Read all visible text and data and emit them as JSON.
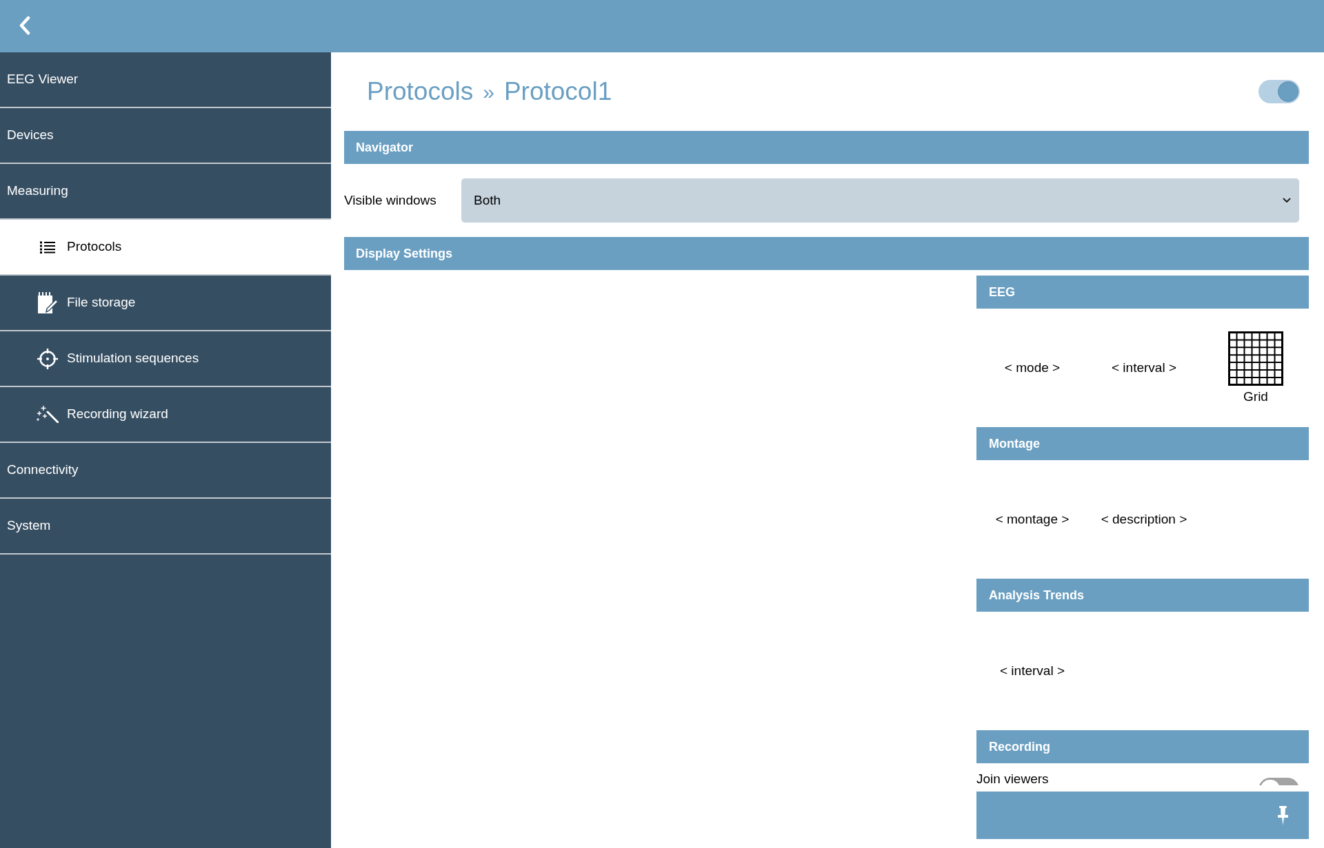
{
  "sidebar": {
    "items": [
      {
        "label": "EEG Viewer",
        "selected": false
      },
      {
        "label": "Devices",
        "selected": false
      },
      {
        "label": "Measuring",
        "selected": false,
        "children": [
          {
            "label": "Protocols",
            "selected": true
          },
          {
            "label": "File storage",
            "selected": false
          },
          {
            "label": "Stimulation sequences",
            "selected": false
          },
          {
            "label": "Recording wizard",
            "selected": false
          }
        ]
      },
      {
        "label": "Connectivity",
        "selected": false
      },
      {
        "label": "System",
        "selected": false
      }
    ]
  },
  "page": {
    "breadcrumb": [
      {
        "label": "Protocols"
      },
      {
        "label": "Protocol1"
      }
    ],
    "separator": "»",
    "toggle": {
      "on": true
    }
  },
  "navigator": {
    "title": "Navigator",
    "fields": [
      {
        "label": "Visible windows",
        "value": "Both"
      }
    ]
  },
  "display_settings": {
    "title": "Display Settings",
    "groups": [
      {
        "title": "EEG",
        "items": [
          {
            "kind": "stepper",
            "label": "< mode >"
          },
          {
            "kind": "stepper",
            "label": "< interval >"
          },
          {
            "kind": "grid",
            "label": "Grid"
          }
        ]
      },
      {
        "title": "Montage",
        "items": [
          {
            "kind": "stepper",
            "label": "< montage >"
          },
          {
            "kind": "stepper",
            "label": "< description >"
          }
        ]
      },
      {
        "title": "Analysis Trends",
        "items": [
          {
            "kind": "stepper",
            "label": "< interval >"
          }
        ]
      },
      {
        "title": "Recording",
        "items": [
          {
            "kind": "switch",
            "label": "Join viewers",
            "on": false
          }
        ]
      }
    ]
  }
}
